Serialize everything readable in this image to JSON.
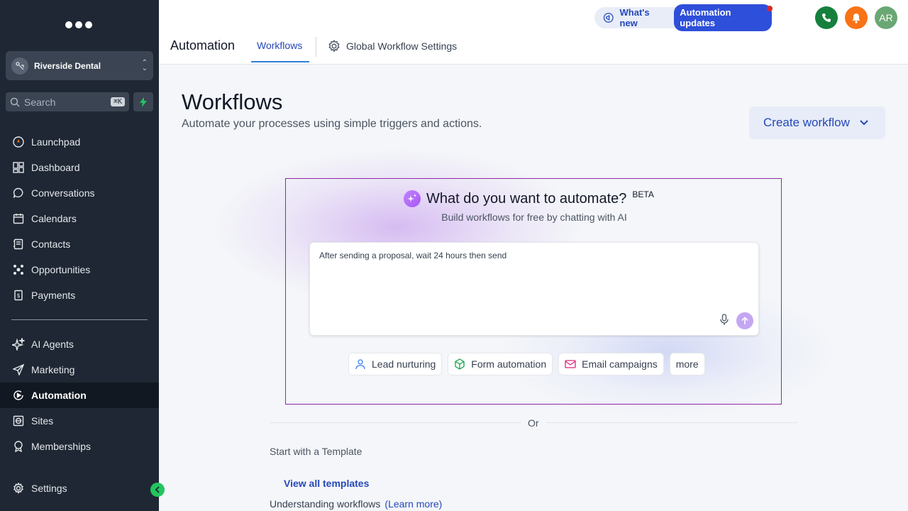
{
  "sidebar": {
    "account_name": "Riverside Dental",
    "search_placeholder": "Search",
    "search_shortcut": "⌘K",
    "nav_main": [
      {
        "label": "Launchpad",
        "icon": "rocket-icon"
      },
      {
        "label": "Dashboard",
        "icon": "dashboard-icon"
      },
      {
        "label": "Conversations",
        "icon": "chat-icon"
      },
      {
        "label": "Calendars",
        "icon": "calendar-icon"
      },
      {
        "label": "Contacts",
        "icon": "contacts-icon"
      },
      {
        "label": "Opportunities",
        "icon": "opportunities-icon"
      },
      {
        "label": "Payments",
        "icon": "payments-icon"
      }
    ],
    "nav_secondary": [
      {
        "label": "AI Agents",
        "icon": "sparkle-icon"
      },
      {
        "label": "Marketing",
        "icon": "send-icon"
      },
      {
        "label": "Automation",
        "icon": "automation-icon",
        "active": true
      },
      {
        "label": "Sites",
        "icon": "globe-icon"
      },
      {
        "label": "Memberships",
        "icon": "badge-icon"
      }
    ],
    "settings_label": "Settings"
  },
  "header": {
    "whats_new": "What's new",
    "updates_pill": "Automation updates",
    "avatar_initials": "AR",
    "page_heading": "Automation",
    "tabs": {
      "workflows": "Workflows",
      "global_settings": "Global Workflow Settings"
    }
  },
  "main": {
    "title": "Workflows",
    "subtitle": "Automate your processes using simple triggers and actions.",
    "create_button": "Create workflow",
    "ai": {
      "title": "What do you want to automate?",
      "badge": "BETA",
      "subtitle": "Build workflows for free by chatting with AI",
      "prompt_value": "After sending a proposal, wait 24 hours then send",
      "chips": [
        "Lead nurturing",
        "Form automation",
        "Email campaigns",
        "more"
      ]
    },
    "or_text": "Or",
    "template_title": "Start with a Template",
    "view_all": "View all templates",
    "understanding": "Understanding workflows",
    "learn_more": "(Learn more)"
  },
  "colors": {
    "sidebar_bg": "#1e2733",
    "accent_blue": "#2548b8",
    "ai_border": "#8e2a9f",
    "phone_green": "#15803d",
    "bell_orange": "#f97316",
    "avatar_green": "#6aa774"
  }
}
